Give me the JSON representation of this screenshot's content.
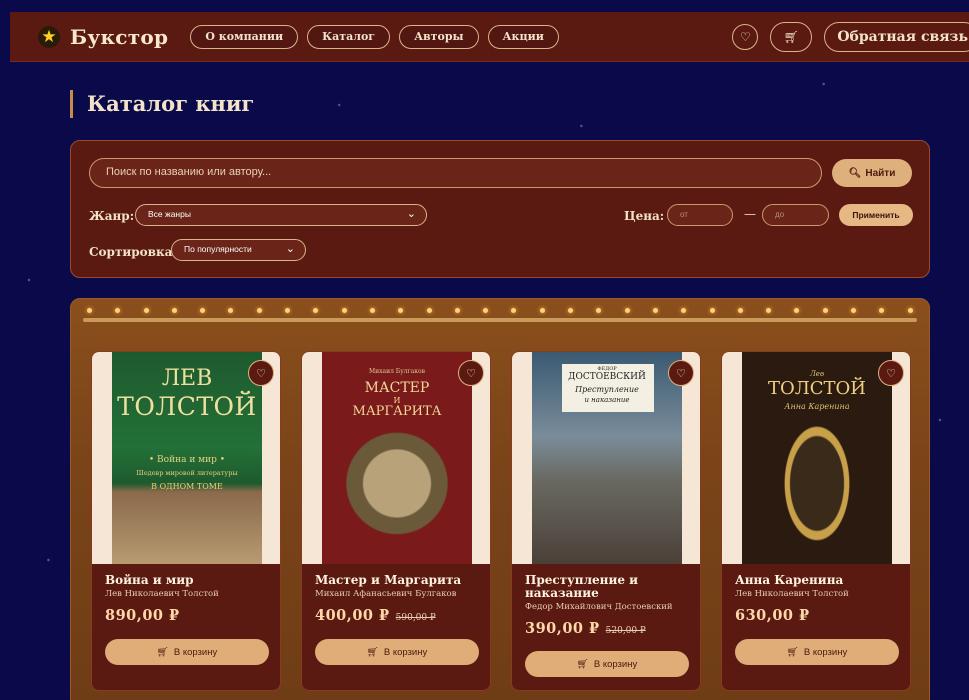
{
  "header": {
    "brand": "Букстор",
    "star_icon": "star-icon",
    "nav": [
      "О компании",
      "Каталог",
      "Авторы",
      "Акции"
    ],
    "feedback_label": "Обратная связь"
  },
  "page": {
    "title": "Каталог книг"
  },
  "filters": {
    "search_placeholder": "Поиск по названию или автору...",
    "find_label": "Найти",
    "genre_label": "Жанр:",
    "genre_value": "Все жанры",
    "price_label": "Цена:",
    "price_from_placeholder": "от",
    "price_to_placeholder": "до",
    "price_dash": "—",
    "apply_label": "Применить",
    "sort_label": "Сортировка:",
    "sort_value": "По популярности"
  },
  "books": [
    {
      "title": "Война и мир",
      "author": "Лев Николаевич Толстой",
      "price": "890,00 ₽",
      "old_price": "",
      "cart_label": "В корзину",
      "cover": {
        "line1": "ЛЕВ",
        "line2": "ТОЛСТОЙ",
        "line3": "• Война и мир •",
        "line4": "Шедевр мировой литературы",
        "line5": "В ОДНОМ ТОМЕ"
      }
    },
    {
      "title": "Мастер и Маргарита",
      "author": "Михаил Афанасьевич Булгаков",
      "price": "400,00 ₽",
      "old_price": "590,00 ₽",
      "cart_label": "В корзину",
      "cover": {
        "line1": "Михаил Булгаков",
        "line2": "МАСТЕР",
        "line3": "И",
        "line4": "МАРГАРИТА"
      }
    },
    {
      "title": "Преступление и наказание",
      "author": "Федор Михайлович Достоевский",
      "price": "390,00 ₽",
      "old_price": "520,00 ₽",
      "cart_label": "В корзину",
      "cover": {
        "line1": "ФЕДОР",
        "line2": "ДОСТОЕВСКИЙ",
        "line3": "Преступление",
        "line4": "и наказание"
      }
    },
    {
      "title": "Анна Каренина",
      "author": "Лев Николаевич Толстой",
      "price": "630,00 ₽",
      "old_price": "",
      "cart_label": "В корзину",
      "cover": {
        "line1": "Лев",
        "line2": "ТОЛСТОЙ",
        "line3": "Анна Каренина"
      }
    }
  ]
}
